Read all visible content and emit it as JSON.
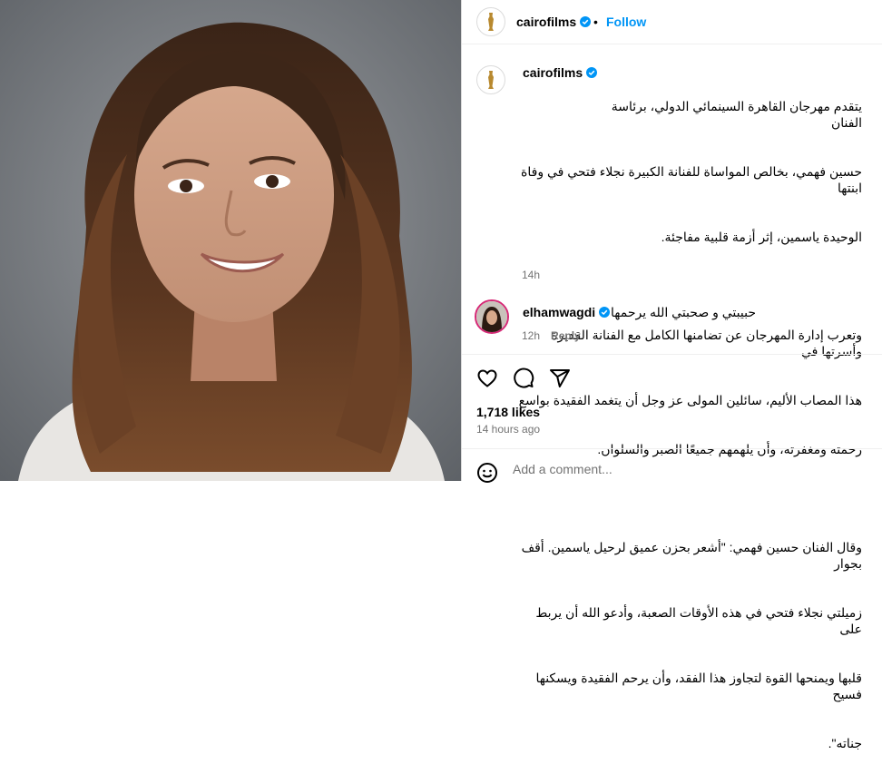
{
  "post": {
    "account": "cairofilms",
    "follow_label": "Follow",
    "separator": "•",
    "caption_lines": [
      "يتقدم مهرجان القاهرة السينمائي الدولي، برئاسة الفنان",
      "حسين فهمي، بخالص المواساة للفنانة الكبيرة نجلاء فتحي في وفاة ابنتها",
      "الوحيدة ياسمين، إثر أزمة قلبية مفاجئة.",
      "",
      "وتعرب إدارة المهرجان عن تضامنها الكامل مع الفنانة القديرة وأسرتها في",
      "هذا المصاب الأليم، سائلين المولى عز وجل أن يتغمد الفقيدة بواسع",
      "رحمته ومغفرته، وأن يلهمهم جميعًا الصبر والسلوان.",
      "",
      "وقال الفنان حسين فهمي: \"أشعر بحزن عميق لرحيل ياسمين. أقف بجوار",
      "زميلتي نجلاء فتحي في هذه الأوقات الصعبة، وأدعو الله أن يربط على",
      "قلبها ويمنحها القوة لتجاوز هذا الفقد، وأن يرحم الفقيدة ويسكنها فسيح",
      "جناته\"."
    ],
    "caption_time": "14h",
    "likes": "1,718 likes",
    "posted_ago": "14 hours ago"
  },
  "comment": {
    "user": "elhamwagdi",
    "text": "حبيبتي و صحبتي الله يرحمها",
    "time": "12h",
    "reply_label": "Reply"
  },
  "composer": {
    "placeholder": "Add a comment..."
  },
  "colors": {
    "accent": "#0095f6",
    "verified": "#0095f6",
    "muted": "#737373"
  },
  "icons": [
    "logo-statuette-icon",
    "verified-badge-icon",
    "heart-icon",
    "comment-icon",
    "share-icon",
    "emoji-icon"
  ]
}
